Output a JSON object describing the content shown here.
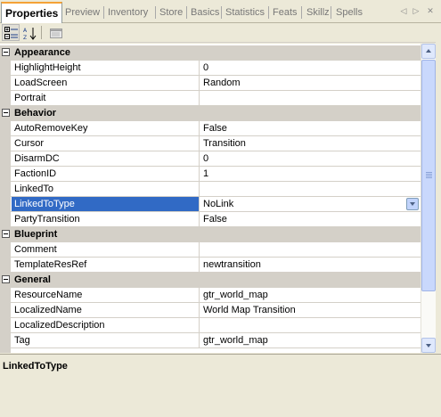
{
  "tabs": [
    {
      "label": "Properties",
      "active": true
    },
    {
      "label": "Preview"
    },
    {
      "label": "Inventory"
    },
    {
      "label": "Store"
    },
    {
      "label": "Basics"
    },
    {
      "label": "Statistics"
    },
    {
      "label": "Feats"
    },
    {
      "label": "Skillz"
    },
    {
      "label": "Spells"
    }
  ],
  "tab_nav": {
    "prev": "◁",
    "next": "▷",
    "close": "✕"
  },
  "toolbar": {
    "categorized_icon": "categorized-icon",
    "alphabetical_icon": "alphabetical-icon",
    "property_pages_icon": "property-pages-icon"
  },
  "grid": {
    "categories": [
      {
        "name": "Appearance",
        "properties": [
          {
            "name": "HighlightHeight",
            "value": "0"
          },
          {
            "name": "LoadScreen",
            "value": "Random"
          },
          {
            "name": "Portrait",
            "value": ""
          }
        ]
      },
      {
        "name": "Behavior",
        "properties": [
          {
            "name": "AutoRemoveKey",
            "value": "False"
          },
          {
            "name": "Cursor",
            "value": "Transition"
          },
          {
            "name": "DisarmDC",
            "value": "0"
          },
          {
            "name": "FactionID",
            "value": "1"
          },
          {
            "name": "LinkedTo",
            "value": ""
          },
          {
            "name": "LinkedToType",
            "value": "NoLink",
            "selected": true
          },
          {
            "name": "PartyTransition",
            "value": "False"
          }
        ]
      },
      {
        "name": "Blueprint",
        "properties": [
          {
            "name": "Comment",
            "value": ""
          },
          {
            "name": "TemplateResRef",
            "value": "newtransition"
          }
        ]
      },
      {
        "name": "General",
        "properties": [
          {
            "name": "ResourceName",
            "value": "gtr_world_map"
          },
          {
            "name": "LocalizedName",
            "value": "World Map Transition"
          },
          {
            "name": "LocalizedDescription",
            "value": ""
          },
          {
            "name": "Tag",
            "value": "gtr_world_map"
          }
        ]
      }
    ]
  },
  "description": {
    "title": "LinkedToType"
  },
  "colors": {
    "selection": "#316ac5",
    "category_bg": "#d4d0c8",
    "active_tab_accent": "#f4a236"
  }
}
